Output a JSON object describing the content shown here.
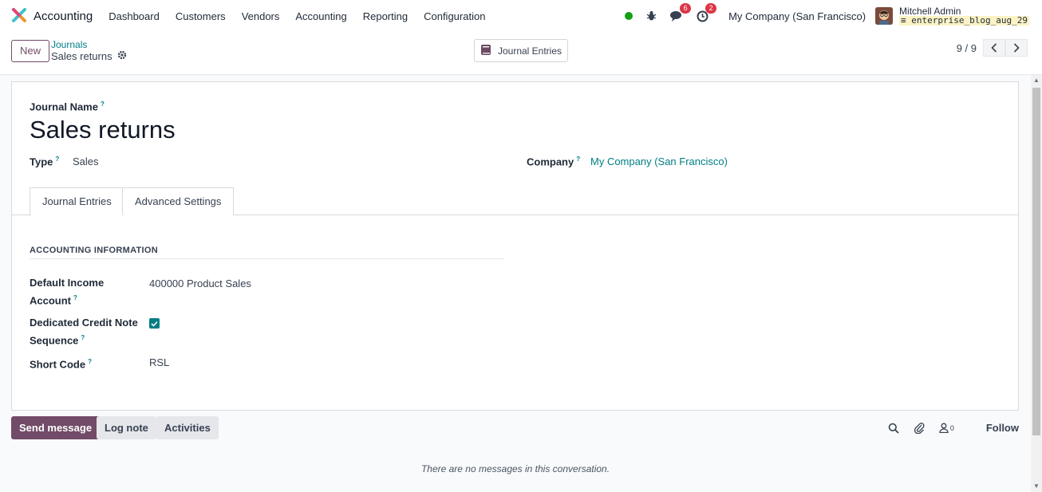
{
  "navbar": {
    "app_name": "Accounting",
    "menu": [
      "Dashboard",
      "Customers",
      "Vendors",
      "Accounting",
      "Reporting",
      "Configuration"
    ],
    "chat_badge": "6",
    "activity_badge": "2",
    "company": "My Company (San Francisco)",
    "user_name": "Mitchell Admin",
    "database": "enterprise_blog_aug_29"
  },
  "control_panel": {
    "new_label": "New",
    "breadcrumb_parent": "Journals",
    "record_title": "Sales returns",
    "smart_button_label": "Journal Entries",
    "pager_value": "9 / 9"
  },
  "form": {
    "journal_name_label": "Journal Name",
    "journal_name": "Sales returns",
    "type_label": "Type",
    "type_value": "Sales",
    "company_label": "Company",
    "company_value": "My Company (San Francisco)",
    "help_mark": "?",
    "tabs": [
      "Journal Entries",
      "Advanced Settings"
    ],
    "section_title": "ACCOUNTING INFORMATION",
    "default_income_label_1": "Default Income",
    "default_income_label_2": "Account",
    "default_income_value": "400000 Product Sales",
    "credit_note_label_1": "Dedicated Credit Note",
    "credit_note_label_2": "Sequence",
    "credit_note_checked": true,
    "short_code_label": "Short Code",
    "short_code_value": "RSL"
  },
  "chatter": {
    "send_message": "Send message",
    "log_note": "Log note",
    "activities": "Activities",
    "followers_count": "0",
    "follow": "Follow",
    "empty_text": "There are no messages in this conversation."
  },
  "colors": {
    "brand_purple": "#714b67",
    "link_teal": "#017e84",
    "badge_red": "#dc3545",
    "presence_green": "#10a010"
  }
}
